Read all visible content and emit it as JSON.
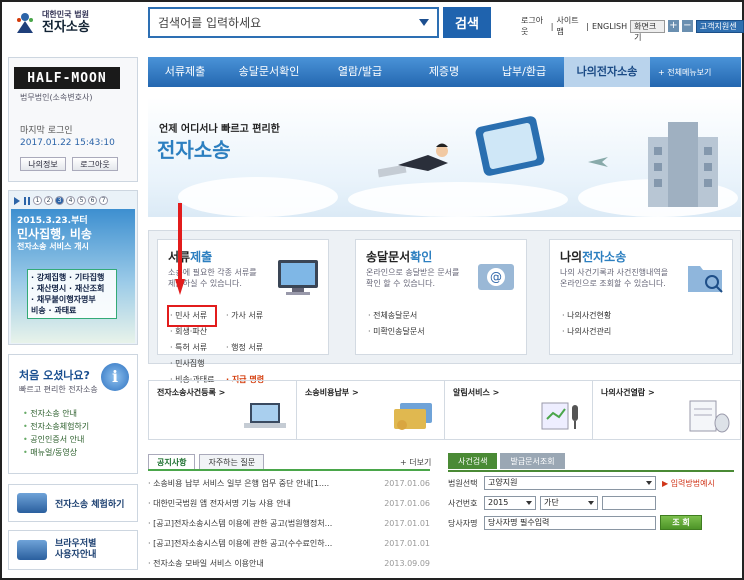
{
  "header": {
    "logo_top": "대한민국 법원",
    "logo_bottom": "전자소송",
    "search_placeholder": "검색어를 입력하세요",
    "search_button": "검색",
    "links": [
      "로그아웃",
      "사이트맵",
      "ENGLISH"
    ],
    "font_size_label": "화면크기",
    "help_center": "고객지원센터"
  },
  "nav": {
    "items": [
      "서류제출",
      "송달문서확인",
      "열람/발급",
      "제증명",
      "납부/환급",
      "나의전자소송"
    ],
    "active_index": 5,
    "all_menu": "+ 전체메뉴보기"
  },
  "user": {
    "firm_logo": "HALF-MOON",
    "firm_name": "법무법인(소속변호사)",
    "last_login_label": "마지막 로그인",
    "last_login_time": "2017.01.22 15:43:10",
    "my_info": "나의정보",
    "logout": "로그아웃"
  },
  "banner": {
    "pages": [
      "1",
      "2",
      "3",
      "4",
      "5",
      "6",
      "7"
    ],
    "current_page": 3,
    "line1": "2015.3.23.부터",
    "line2": "민사집행, 비송",
    "line3": "전자소송 서비스 개시",
    "items": [
      "· 강제집행 · 기타집행",
      "· 재산명시 · 재산조회",
      "· 채무불이행자명부",
      "  비송         · 과태료"
    ]
  },
  "first_visit": {
    "title": "처음 오셨나요?",
    "subtitle": "빠르고 편리한 전자소송",
    "links": [
      "전자소송 안내",
      "전자소송체험하기",
      "공인인증서 안내",
      "매뉴얼/동영상"
    ]
  },
  "experience": {
    "label": "전자소송 체험하기"
  },
  "browser": {
    "label_line1": "브라우저별",
    "label_line2": "사용자안내"
  },
  "hero": {
    "subtitle": "언제 어디서나 빠르고 편리한",
    "title": "전자소송"
  },
  "services": [
    {
      "title_plain": "서류",
      "title_accent": "제출",
      "desc": [
        "소송에 필요한 각종 서류를",
        "제출하실 수 있습니다."
      ],
      "links": [
        "· 민사 서류",
        "· 가사 서류",
        "· 회생·파산",
        "· 특허 서류",
        "· 행정 서류",
        "· 민사집행",
        "· 비송·과태료",
        "· 지급 명령"
      ]
    },
    {
      "title_plain": "송달문서",
      "title_accent": "확인",
      "desc": [
        "온라인으로 송달받은 문서를",
        "확인 할 수 있습니다."
      ],
      "links": [
        "· 전체송달문서",
        "· 미확인송달문서"
      ]
    },
    {
      "title_plain": "나의",
      "title_accent": "전자소송",
      "desc": [
        "나의 사건기록과 사건진행내역을",
        "온라인으로 조회할 수 있습니다."
      ],
      "links": [
        "· 나의사건현황",
        "· 나의사건관리"
      ]
    }
  ],
  "quick": [
    "전자소송사건등록 >",
    "소송비용납부 >",
    "알림서비스 >",
    "나의사건열람 >"
  ],
  "notices": {
    "tab_active": "공지사항",
    "tab_other": "자주하는 질문",
    "more": "+ 더보기",
    "items": [
      {
        "title": "· 소송비용 납부 서비스 일부 은행 업무 중단 안내[1....",
        "date": "2017.01.06"
      },
      {
        "title": "· 대한민국법원 앱 전자서명 기능 사용 안내",
        "date": "2017.01.06"
      },
      {
        "title": "· [공고]전자소송시스템 이용에 관한 공고(법원행정처...",
        "date": "2017.01.01"
      },
      {
        "title": "· [공고]전자소송시스템 이용에 관한 공고(수수료인하...",
        "date": "2017.01.01"
      },
      {
        "title": "· 전자소송 모바일 서비스 이용안내",
        "date": "2013.09.09"
      }
    ]
  },
  "case_search": {
    "tab_active": "사건검색",
    "tab_other": "발급문서조회",
    "court_label": "법원선택",
    "court_value": "고양지원",
    "howto": "▶ 입력방법예시",
    "case_label": "사건번호",
    "year_value": "2015",
    "type_value": "가단",
    "party_label": "당사자명",
    "party_value": "당사자명 필수입력",
    "search_button": "조 회"
  }
}
